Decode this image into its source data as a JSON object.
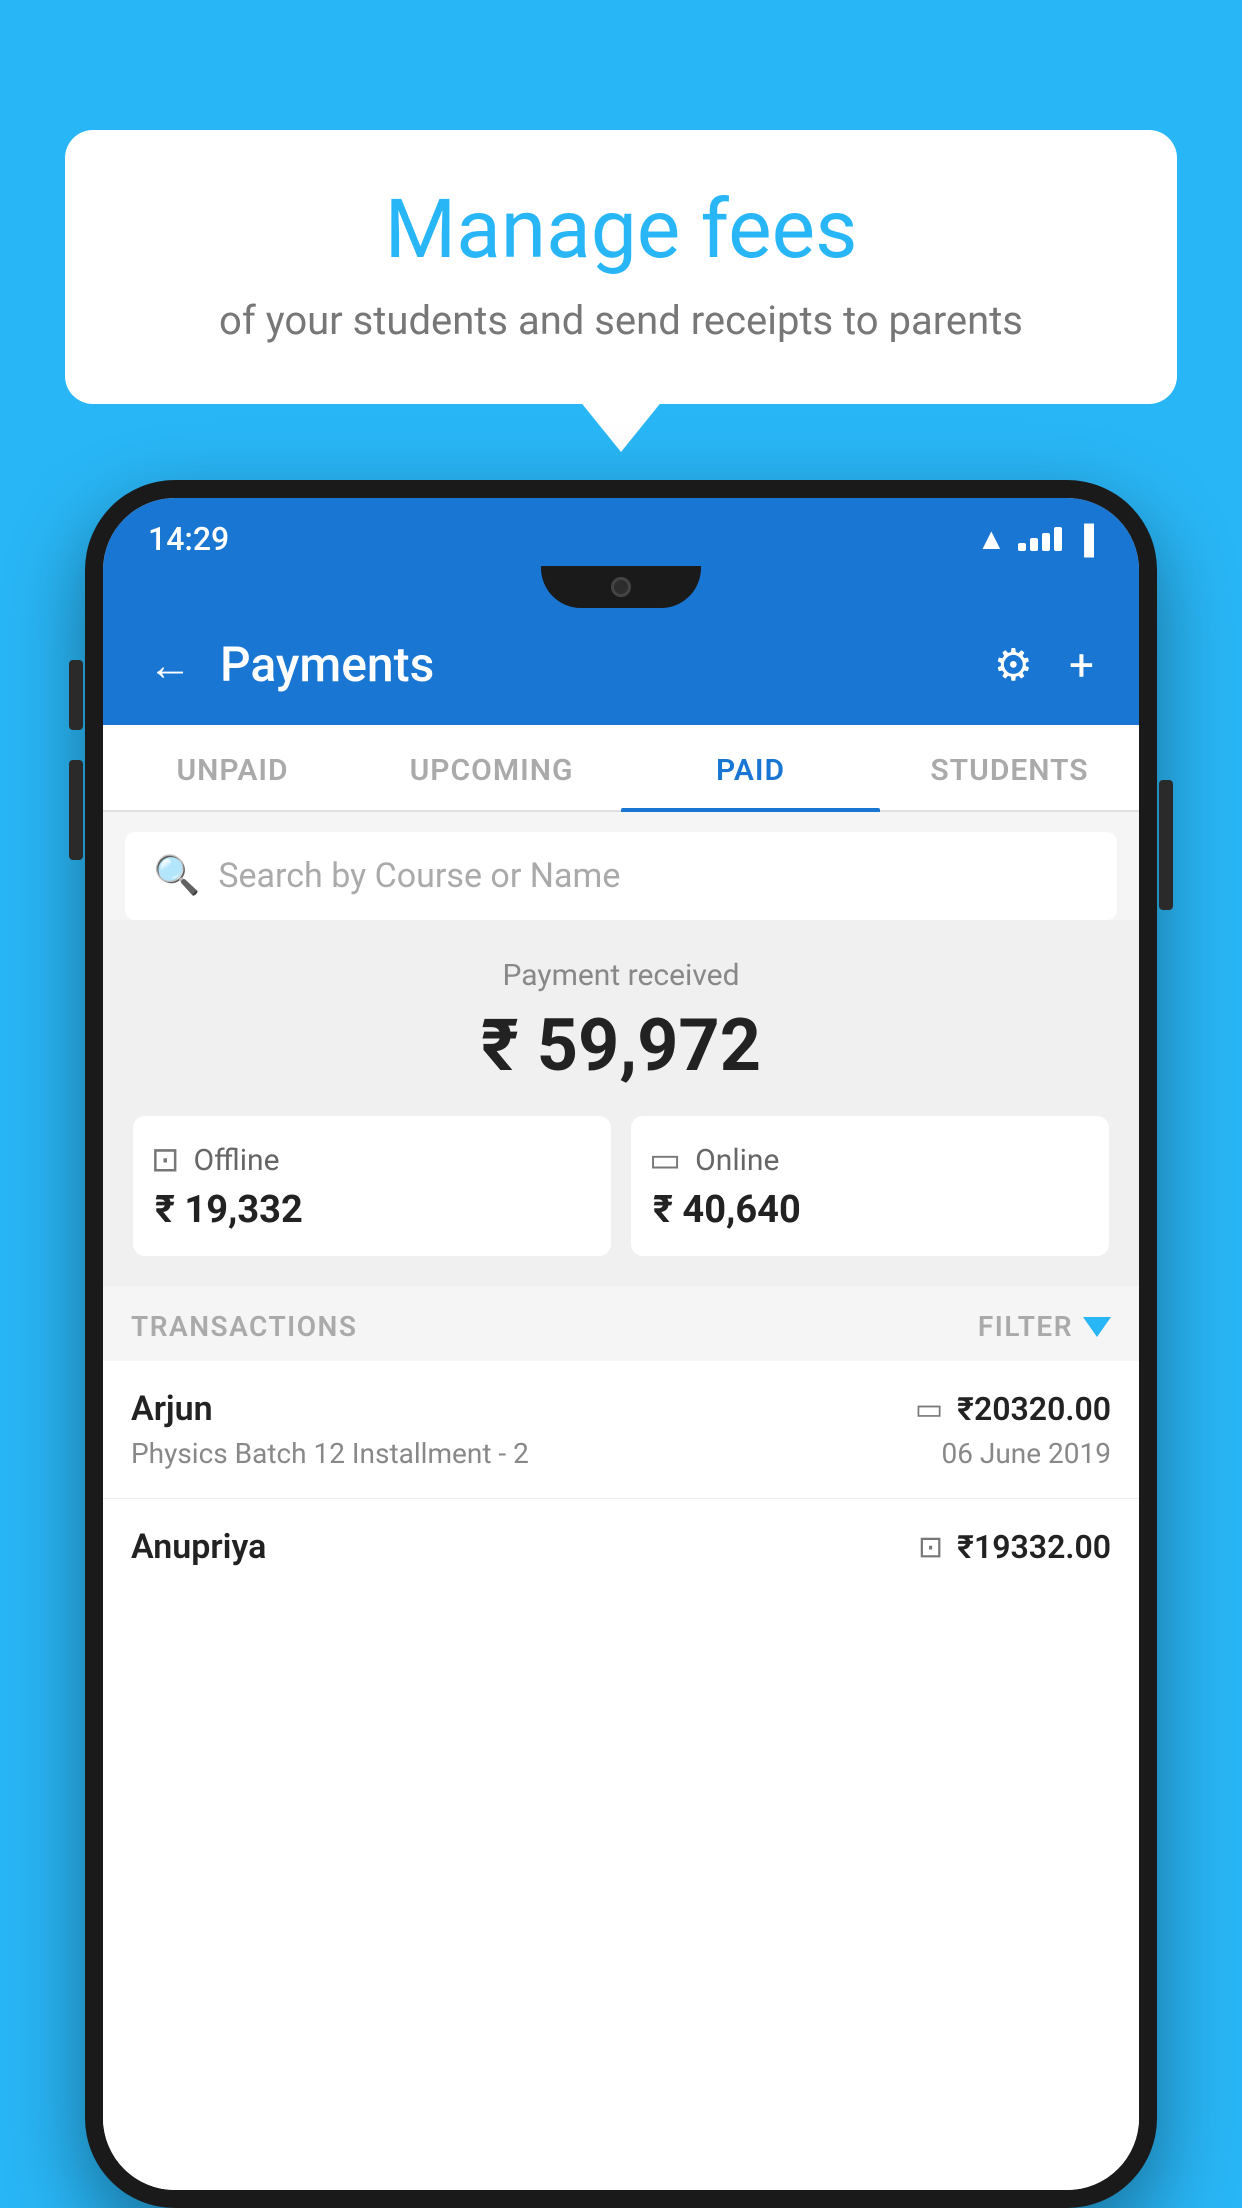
{
  "background_color": "#29B6F6",
  "speech_bubble": {
    "title": "Manage fees",
    "subtitle": "of your students and send receipts to parents"
  },
  "status_bar": {
    "time": "14:29",
    "wifi": "▲",
    "battery": "▐"
  },
  "header": {
    "title": "Payments",
    "back_label": "←",
    "settings_label": "⚙",
    "add_label": "+"
  },
  "tabs": [
    {
      "label": "UNPAID",
      "active": false
    },
    {
      "label": "UPCOMING",
      "active": false
    },
    {
      "label": "PAID",
      "active": true
    },
    {
      "label": "STUDENTS",
      "active": false
    }
  ],
  "search": {
    "placeholder": "Search by Course or Name"
  },
  "payment_summary": {
    "label": "Payment received",
    "amount": "₹ 59,972",
    "offline": {
      "label": "Offline",
      "amount": "₹ 19,332"
    },
    "online": {
      "label": "Online",
      "amount": "₹ 40,640"
    }
  },
  "transactions": {
    "section_label": "TRANSACTIONS",
    "filter_label": "FILTER",
    "items": [
      {
        "name": "Arjun",
        "course": "Physics Batch 12 Installment - 2",
        "amount": "₹20320.00",
        "date": "06 June 2019",
        "payment_type": "online"
      },
      {
        "name": "Anupriya",
        "course": "",
        "amount": "₹19332.00",
        "date": "",
        "payment_type": "offline"
      }
    ]
  }
}
